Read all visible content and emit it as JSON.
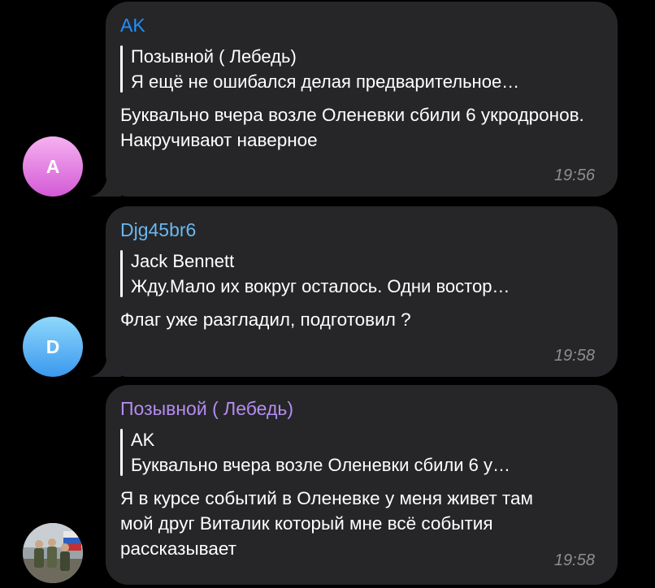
{
  "messages": [
    {
      "sender": "AK",
      "sender_color": "#1e90ff",
      "avatar_letter": "A",
      "avatar_gradient": [
        "#f6b1f0",
        "#d35ad6"
      ],
      "reply_name": "Позывной ( Лебедь)",
      "reply_text": "Я ещё не ошибался делая предварительное…",
      "body": "Буквально вчера возле Оленевки сбили 6 укродронов. Накручивают наверное",
      "time": "19:56"
    },
    {
      "sender": "Djg45br6",
      "sender_color": "#6ab7f0",
      "avatar_letter": "D",
      "avatar_gradient": [
        "#8fd8fb",
        "#3a98ee"
      ],
      "reply_name": "Jack Bennett",
      "reply_text": "Жду.Мало их вокруг осталось. Одни востор…",
      "body": "Флаг уже разгладил, подготовил ?",
      "time": "19:58"
    },
    {
      "sender": "Позывной ( Лебедь)",
      "sender_color": "#b48cf0",
      "avatar_letter": "",
      "reply_name": "AK",
      "reply_text": "Буквально вчера возле Оленевки сбили 6 у…",
      "body": "Я в курсе событий в Оленевке у меня живет там мой друг Виталик который мне всё события рассказывает",
      "time": "19:58"
    }
  ],
  "colors": {
    "background": "#000000",
    "bubble": "#262628",
    "text": "#ffffff",
    "timestamp": "#8d8d93"
  }
}
